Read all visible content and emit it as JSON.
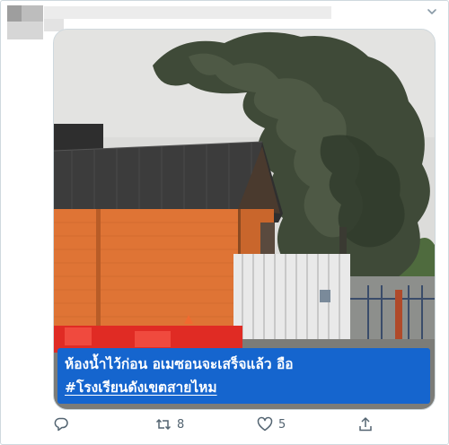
{
  "tweet": {
    "caption_line1": "ห้องน้ำไว้ก่อน อเมซอนจะเสร็จแล้ว อือ",
    "caption_line2": "#โรงเรียนดังเขตสายไหม",
    "icons": {
      "more": "chevron-down-icon",
      "reply": "reply-icon",
      "retweet": "retweet-icon",
      "like": "heart-icon",
      "share": "share-icon"
    }
  },
  "actions": {
    "retweet_count": "8",
    "like_count": "5"
  },
  "colors": {
    "caption_bg": "#1565ce",
    "icon": "#536471",
    "border": "#cfd9de"
  }
}
